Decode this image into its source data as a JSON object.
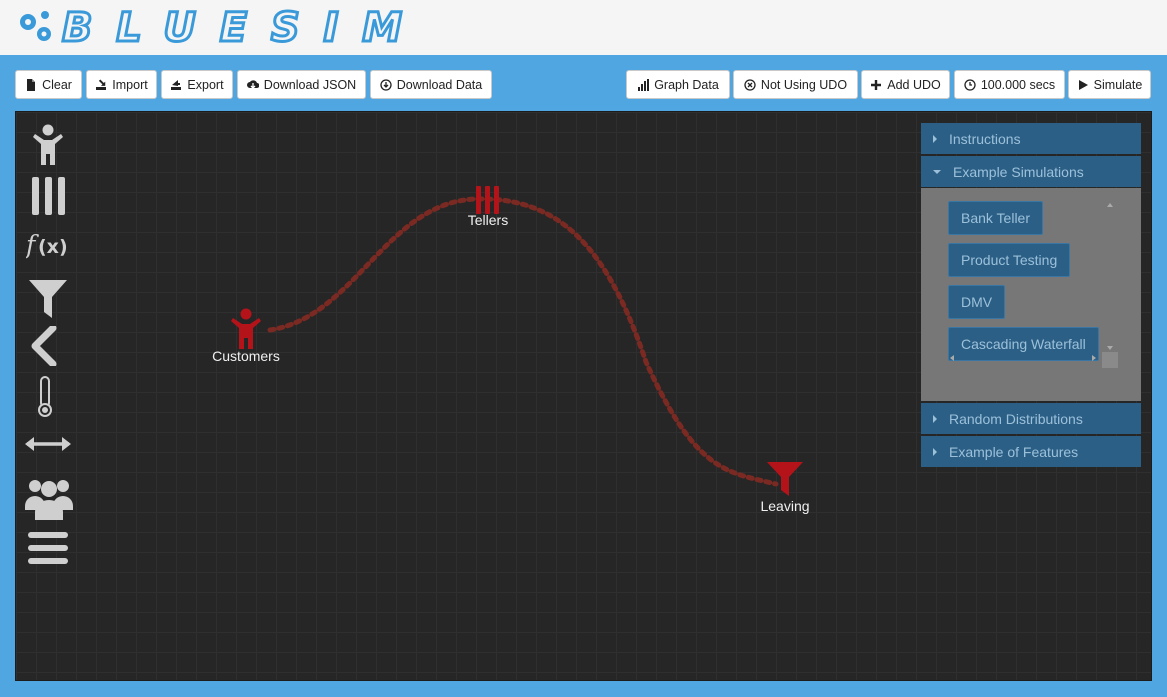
{
  "app": {
    "logo_text": "BLUESIM"
  },
  "toolbar": {
    "clear": "Clear",
    "import": "Import",
    "export": "Export",
    "download_json": "Download JSON",
    "download_data": "Download Data",
    "graph_data": "Graph Data",
    "udo_status": "Not Using UDO",
    "add_udo": "Add UDO",
    "duration": "100.000 secs",
    "simulate": "Simulate"
  },
  "palette": {
    "items": [
      "person-icon",
      "queue-bars-icon",
      "function-icon",
      "funnel-icon",
      "chevron-left-icon",
      "thermometer-icon",
      "double-arrow-icon",
      "group-icon",
      "menu-lines-icon"
    ]
  },
  "diagram": {
    "nodes": [
      {
        "label": "Customers",
        "icon": "person-icon"
      },
      {
        "label": "Tellers",
        "icon": "queue-bars-icon"
      },
      {
        "label": "Leaving",
        "icon": "funnel-icon"
      }
    ],
    "node_color": "#b5131a",
    "link_color": "#7a2a22"
  },
  "sidebar": {
    "sections": [
      "Instructions",
      "Example Simulations",
      "Random Distributions",
      "Example of Features"
    ],
    "examples": [
      "Bank Teller",
      "Product Testing",
      "DMV",
      "Cascading Waterfall"
    ]
  },
  "colors": {
    "accent": "#4fa6e0",
    "canvas": "#262626",
    "panel": "#2b5f85"
  }
}
